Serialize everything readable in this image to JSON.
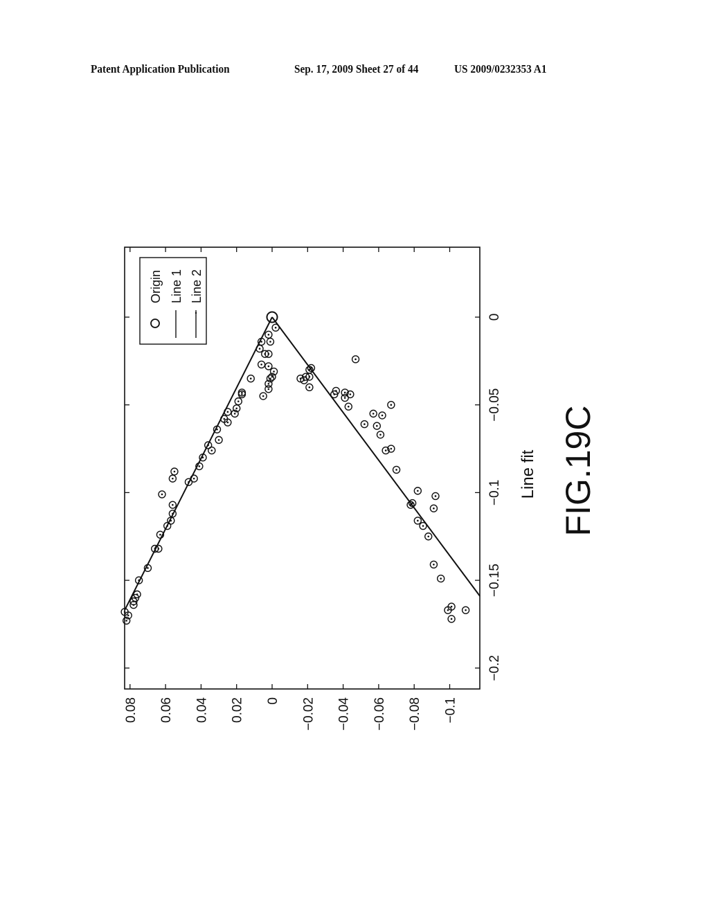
{
  "header": {
    "left": "Patent Application Publication",
    "middle": "Sep. 17, 2009   Sheet 27 of 44",
    "right": "US 2009/0232353 A1"
  },
  "figure": {
    "label": "FIG.19C",
    "orientation": "rotated 90 degrees counter-clockwise on page"
  },
  "chart_data": {
    "type": "scatter",
    "title": "Line fit",
    "xlabel": "",
    "ylabel": "",
    "xlim": [
      -0.212,
      0.04
    ],
    "ylim": [
      -0.117,
      0.083
    ],
    "xticks": [
      0,
      -0.05,
      -0.1,
      -0.15,
      -0.2
    ],
    "xtick_labels": [
      "0",
      "−0.05",
      "−0.1",
      "−0.15",
      "−0.2"
    ],
    "yticks": [
      0.08,
      0.06,
      0.04,
      0.02,
      0,
      -0.02,
      -0.04,
      -0.06,
      -0.08,
      -0.1
    ],
    "ytick_labels": [
      "0.08",
      "0.06",
      "0.04",
      "0.02",
      "0",
      "−0.02",
      "−0.04",
      "−0.06",
      "−0.08",
      "−0.1"
    ],
    "grid": false,
    "legend": {
      "placement": "top-left",
      "entries": [
        {
          "label": "Origin",
          "marker": "circle"
        },
        {
          "label": "Line 1",
          "marker": "line"
        },
        {
          "label": "Line 2",
          "marker": "line-dotted"
        }
      ]
    },
    "origin": {
      "x": 0,
      "y": 0
    },
    "lines": [
      {
        "name": "Line 1",
        "points": [
          [
            0,
            0
          ],
          [
            -0.167,
            0.083
          ]
        ]
      },
      {
        "name": "Line 2",
        "points": [
          [
            0,
            0
          ],
          [
            -0.159,
            -0.117
          ]
        ]
      }
    ],
    "series": [
      {
        "name": "Data points",
        "marker": "circle-dot",
        "points": [
          [
            -0.006,
            -0.002
          ],
          [
            -0.01,
            0.002
          ],
          [
            -0.014,
            0.006
          ],
          [
            -0.014,
            0.001
          ],
          [
            -0.018,
            0.007
          ],
          [
            -0.021,
            0.004
          ],
          [
            -0.021,
            0.002
          ],
          [
            -0.027,
            0.006
          ],
          [
            -0.028,
            0.002
          ],
          [
            -0.031,
            -0.001
          ],
          [
            -0.034,
            0.0
          ],
          [
            -0.035,
            0.001
          ],
          [
            -0.035,
            0.012
          ],
          [
            -0.038,
            0.002
          ],
          [
            -0.041,
            0.002
          ],
          [
            -0.045,
            0.005
          ],
          [
            -0.043,
            0.017
          ],
          [
            -0.044,
            0.017
          ],
          [
            -0.048,
            0.019
          ],
          [
            -0.052,
            0.02
          ],
          [
            -0.054,
            0.025
          ],
          [
            -0.055,
            0.021
          ],
          [
            -0.058,
            0.027
          ],
          [
            -0.06,
            0.025
          ],
          [
            -0.064,
            0.031
          ],
          [
            -0.07,
            0.03
          ],
          [
            -0.073,
            0.036
          ],
          [
            -0.076,
            0.034
          ],
          [
            -0.08,
            0.039
          ],
          [
            -0.085,
            0.041
          ],
          [
            -0.092,
            0.044
          ],
          [
            -0.094,
            0.047
          ],
          [
            -0.088,
            0.055
          ],
          [
            -0.092,
            0.056
          ],
          [
            -0.101,
            0.062
          ],
          [
            -0.107,
            0.056
          ],
          [
            -0.112,
            0.056
          ],
          [
            -0.116,
            0.057
          ],
          [
            -0.119,
            0.059
          ],
          [
            -0.124,
            0.063
          ],
          [
            -0.132,
            0.064
          ],
          [
            -0.132,
            0.066
          ],
          [
            -0.143,
            0.07
          ],
          [
            -0.15,
            0.075
          ],
          [
            -0.158,
            0.076
          ],
          [
            -0.16,
            0.077
          ],
          [
            -0.162,
            0.078
          ],
          [
            -0.164,
            0.078
          ],
          [
            -0.168,
            0.083
          ],
          [
            -0.17,
            0.081
          ],
          [
            -0.173,
            0.082
          ],
          [
            -0.029,
            -0.022
          ],
          [
            -0.03,
            -0.021
          ],
          [
            -0.034,
            -0.021
          ],
          [
            -0.034,
            -0.019
          ],
          [
            -0.035,
            -0.016
          ],
          [
            -0.036,
            -0.018
          ],
          [
            -0.04,
            -0.021
          ],
          [
            -0.024,
            -0.047
          ],
          [
            -0.042,
            -0.036
          ],
          [
            -0.044,
            -0.035
          ],
          [
            -0.043,
            -0.041
          ],
          [
            -0.044,
            -0.044
          ],
          [
            -0.046,
            -0.041
          ],
          [
            -0.051,
            -0.043
          ],
          [
            -0.05,
            -0.067
          ],
          [
            -0.055,
            -0.057
          ],
          [
            -0.056,
            -0.062
          ],
          [
            -0.061,
            -0.052
          ],
          [
            -0.062,
            -0.059
          ],
          [
            -0.067,
            -0.061
          ],
          [
            -0.076,
            -0.064
          ],
          [
            -0.075,
            -0.067
          ],
          [
            -0.087,
            -0.07
          ],
          [
            -0.099,
            -0.082
          ],
          [
            -0.102,
            -0.092
          ],
          [
            -0.106,
            -0.079
          ],
          [
            -0.107,
            -0.078
          ],
          [
            -0.109,
            -0.091
          ],
          [
            -0.116,
            -0.082
          ],
          [
            -0.119,
            -0.085
          ],
          [
            -0.125,
            -0.088
          ],
          [
            -0.141,
            -0.091
          ],
          [
            -0.149,
            -0.095
          ],
          [
            -0.165,
            -0.101
          ],
          [
            -0.167,
            -0.099
          ],
          [
            -0.167,
            -0.109
          ],
          [
            -0.172,
            -0.101
          ]
        ]
      }
    ]
  }
}
